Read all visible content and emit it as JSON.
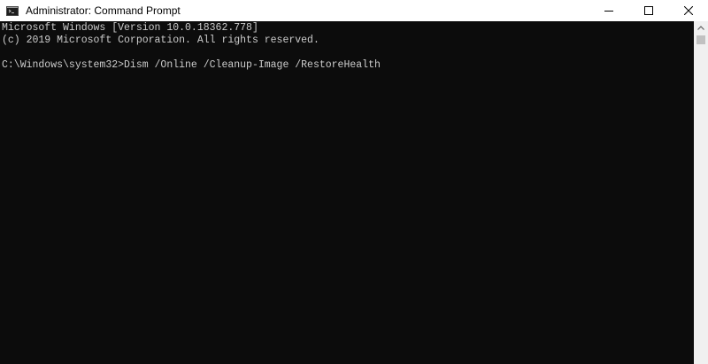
{
  "window": {
    "title": "Administrator: Command Prompt"
  },
  "icons": {
    "app": "console-app-icon",
    "minimize": "minimize-icon",
    "maximize": "maximize-icon",
    "close": "close-icon",
    "scroll_up": "chevron-up-icon"
  },
  "colors": {
    "console_bg": "#0c0c0c",
    "console_fg": "#cccccc",
    "titlebar_bg": "#ffffff",
    "scrollbar_bg": "#f0f0f0",
    "scroll_thumb": "#c1c1c1"
  },
  "console": {
    "lines": [
      "Microsoft Windows [Version 10.0.18362.778]",
      "(c) 2019 Microsoft Corporation. All rights reserved.",
      "",
      "C:\\Windows\\system32>Dism /Online /Cleanup-Image /RestoreHealth"
    ]
  }
}
